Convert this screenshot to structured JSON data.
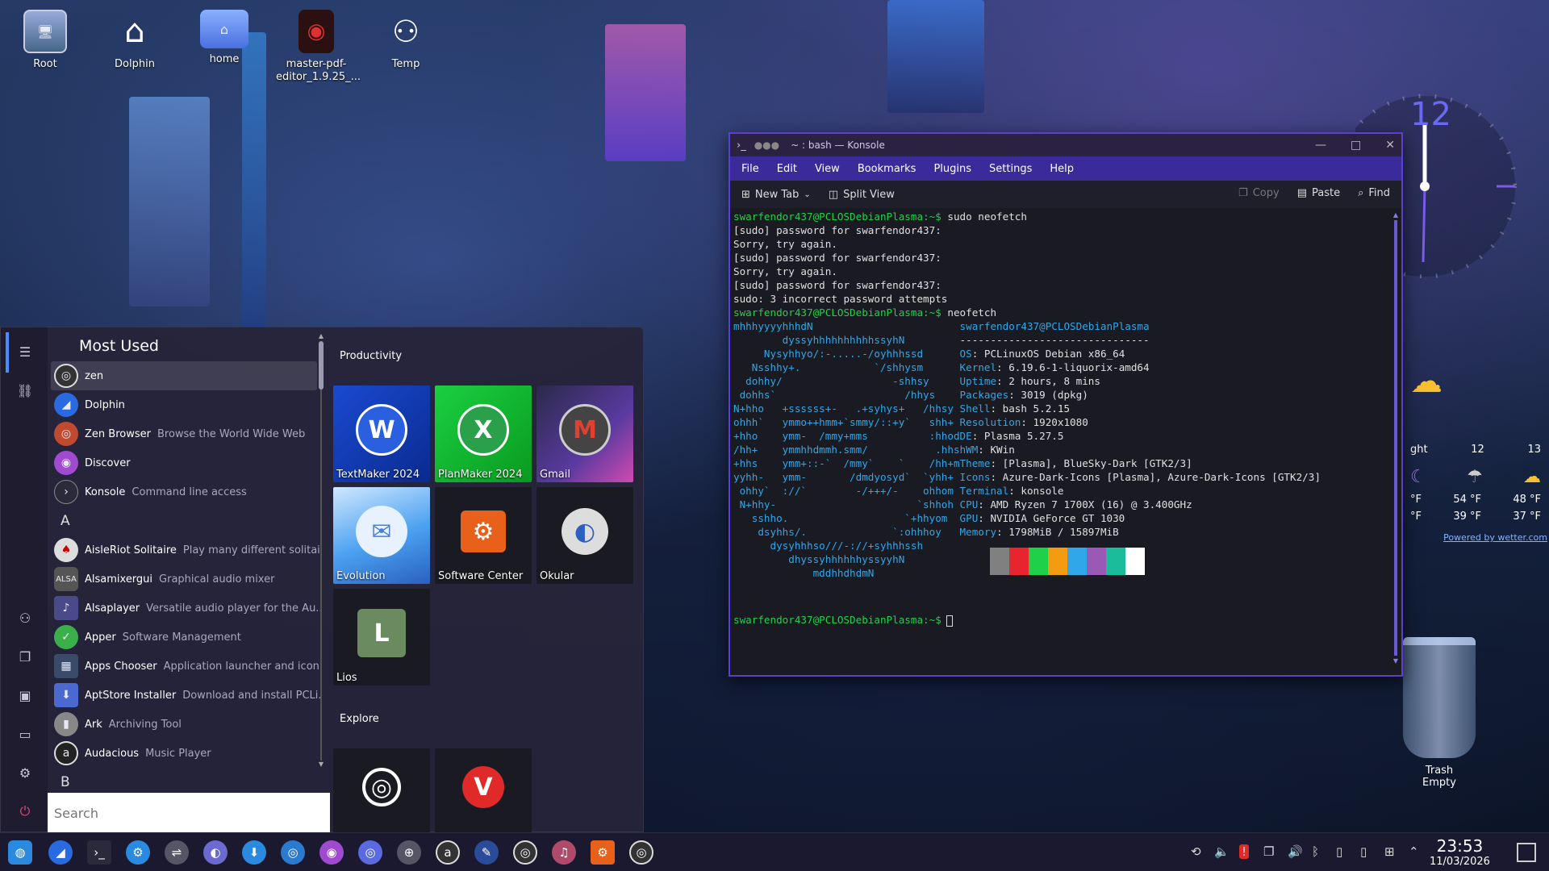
{
  "desktop": {
    "icons": [
      {
        "label": "Root"
      },
      {
        "label": "Dolphin"
      },
      {
        "label": "home"
      },
      {
        "label": "master-pdf-\neditor_1.9.25_..."
      },
      {
        "label": "Temp"
      }
    ],
    "trash": {
      "label": "Trash",
      "status": "Empty"
    }
  },
  "clock_widget": {
    "hour": "12"
  },
  "weather": {
    "labels": [
      "ght",
      "12",
      "13"
    ],
    "highs": [
      "°F",
      "54 °F",
      "48 °F"
    ],
    "lows": [
      "°F",
      "39 °F",
      "37 °F"
    ],
    "credit": "Powered by wetter.com"
  },
  "menu": {
    "most_used_title": "Most Used",
    "most_used": [
      {
        "name": "zen",
        "desc": ""
      },
      {
        "name": "Dolphin",
        "desc": ""
      },
      {
        "name": "Zen Browser",
        "desc": "Browse the World Wide Web"
      },
      {
        "name": "Discover",
        "desc": ""
      },
      {
        "name": "Konsole",
        "desc": "Command line access"
      }
    ],
    "letter_a": "A",
    "apps_a": [
      {
        "name": "AisleRiot Solitaire",
        "desc": "Play many different solitai..."
      },
      {
        "name": "Alsamixergui",
        "desc": "Graphical audio mixer"
      },
      {
        "name": "Alsaplayer",
        "desc": "Versatile audio player for the Au..."
      },
      {
        "name": "Apper",
        "desc": "Software Management"
      },
      {
        "name": "Apps Chooser",
        "desc": "Application launcher and icon..."
      },
      {
        "name": "AptStore Installer",
        "desc": "Download and install PCLi..."
      },
      {
        "name": "Ark",
        "desc": "Archiving Tool"
      },
      {
        "name": "Audacious",
        "desc": "Music Player"
      }
    ],
    "letter_b": "B",
    "search_placeholder": "Search",
    "productivity_title": "Productivity",
    "tiles": [
      {
        "label": "TextMaker 2024",
        "glyph": "W"
      },
      {
        "label": "PlanMaker 2024",
        "glyph": "X"
      },
      {
        "label": "Gmail",
        "glyph": "M"
      },
      {
        "label": "Evolution",
        "glyph": "✉"
      },
      {
        "label": "Software Center",
        "glyph": "⚙"
      },
      {
        "label": "Okular",
        "glyph": "◐"
      },
      {
        "label": "Lios",
        "glyph": "L"
      }
    ],
    "explore_title": "Explore"
  },
  "konsole": {
    "title": "~ : bash — Konsole",
    "menu": [
      "File",
      "Edit",
      "View",
      "Bookmarks",
      "Plugins",
      "Settings",
      "Help"
    ],
    "toolbar": {
      "new_tab": "New Tab",
      "split_view": "Split View",
      "copy": "Copy",
      "paste": "Paste",
      "find": "Find"
    },
    "lines": [
      {
        "p": "swarfendor437@PCLOSDebianPlasma:~$",
        "t": " sudo neofetch"
      },
      {
        "p": "",
        "t": "[sudo] password for swarfendor437:"
      },
      {
        "p": "",
        "t": "Sorry, try again."
      },
      {
        "p": "",
        "t": "[sudo] password for swarfendor437:"
      },
      {
        "p": "",
        "t": "Sorry, try again."
      },
      {
        "p": "",
        "t": "[sudo] password for swarfendor437:"
      },
      {
        "p": "",
        "t": "sudo: 3 incorrect password attempts"
      },
      {
        "p": "swarfendor437@PCLOSDebianPlasma:~$",
        "t": " neofetch"
      }
    ],
    "logo": [
      "mhhhyyyyhhhdN",
      "        dyssyhhhhhhhhhhssyhN",
      "     Nysyhhyo/:-.....-/oyhhhssd",
      "   Nsshhy+.            `/shhysm",
      "  dohhy/                  -shhsy",
      " dohhs`                     /hhys",
      "N+hho   +ssssss+-   .+syhys+   /hhsy",
      "ohhh`   ymmo++hmm+`smmy/::+y`   shh+",
      "+hho    ymm-  /mmy+mms          :hhod",
      "/hh+    ymmhhdmmh.smm/           .hhsh",
      "+hhs    ymm+::-`  /mmy`    `    /hh+m",
      "yyhh-   ymm-       /dmdyosyd`  `yhh+",
      " ohhy`  ://`        -/+++/-    ohhom",
      " N+hhy-                       `shhoh",
      "   sshho.                   `+hhyom",
      "    dsyhhs/.              `:ohhhoy",
      "      dysyhhhso///-://+syhhhssh",
      "         dhyssyhhhhhhyssyyhN",
      "             mddhhdhdmN"
    ],
    "info_user": "swarfendor437@PCLOSDebianPlasma",
    "info_sep": "-------------------------------",
    "info": [
      {
        "k": "OS",
        "v": "PCLinuxOS Debian x86_64"
      },
      {
        "k": "Kernel",
        "v": "6.19.6-1-liquorix-amd64"
      },
      {
        "k": "Uptime",
        "v": "2 hours, 8 mins"
      },
      {
        "k": "Packages",
        "v": "3019 (dpkg)"
      },
      {
        "k": "Shell",
        "v": "bash 5.2.15"
      },
      {
        "k": "Resolution",
        "v": "1920x1080"
      },
      {
        "k": "DE",
        "v": "Plasma 5.27.5"
      },
      {
        "k": "WM",
        "v": "KWin"
      },
      {
        "k": "Theme",
        "v": "[Plasma], BlueSky-Dark [GTK2/3]"
      },
      {
        "k": "Icons",
        "v": "Azure-Dark-Icons [Plasma], Azure-Dark-Icons [GTK2/3]"
      },
      {
        "k": "Terminal",
        "v": "konsole"
      },
      {
        "k": "CPU",
        "v": "AMD Ryzen 7 1700X (16) @ 3.400GHz"
      },
      {
        "k": "GPU",
        "v": "NVIDIA GeForce GT 1030"
      },
      {
        "k": "Memory",
        "v": "1798MiB / 15897MiB"
      }
    ],
    "swatch_colors": [
      "#808080",
      "#e8252e",
      "#1fd14a",
      "#f39c12",
      "#2fa7e8",
      "#9b59b6",
      "#1abc9c",
      "#ffffff"
    ],
    "final_prompt": "swarfendor437@PCLOSDebianPlasma:~$"
  },
  "taskbar": {
    "time": "23:53",
    "date": "11/03/2026"
  }
}
